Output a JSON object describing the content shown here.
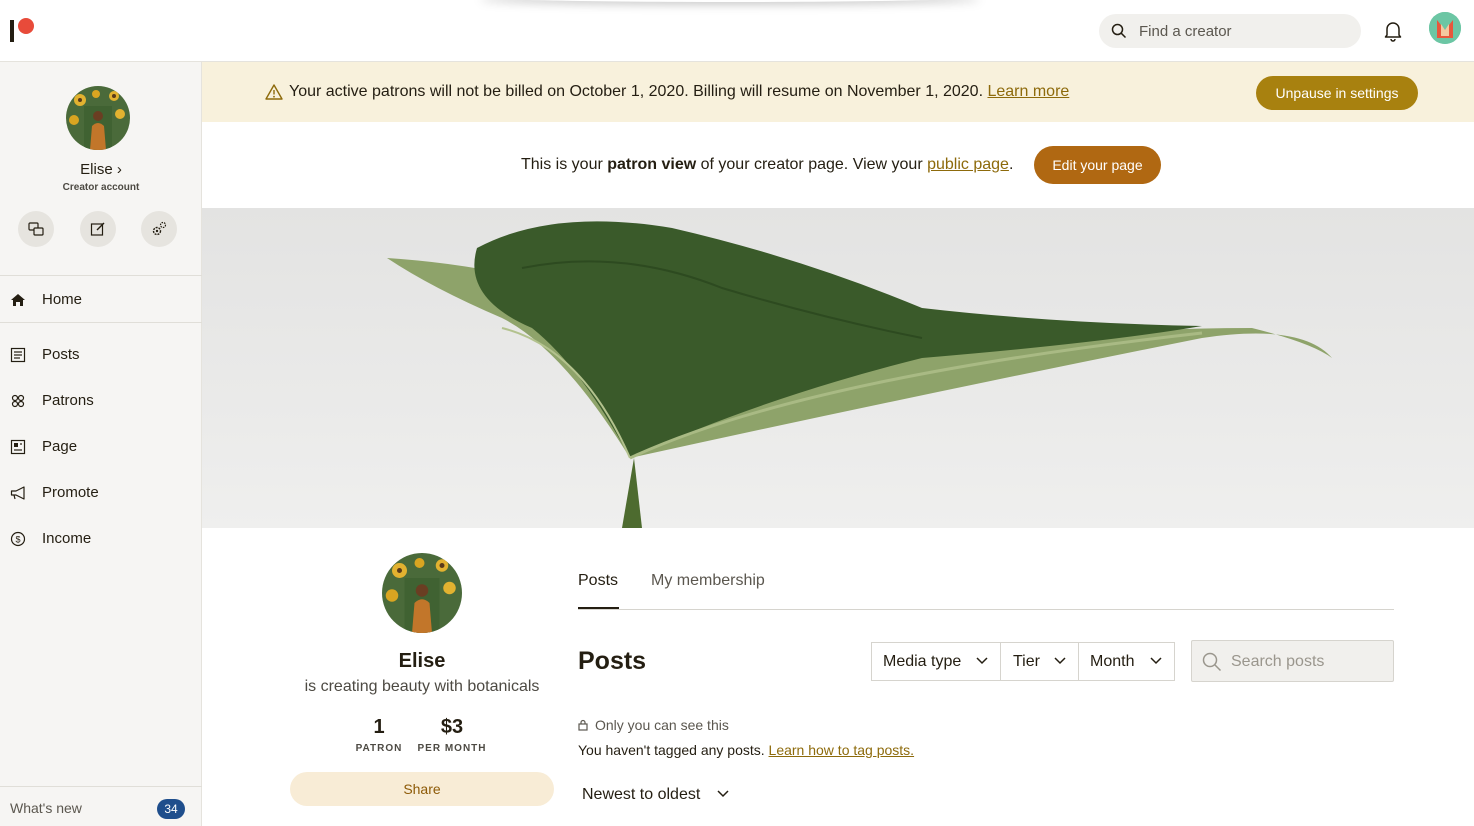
{
  "topbar": {
    "search_placeholder": "Find a creator"
  },
  "sidebar": {
    "profile_name": "Elise",
    "profile_sub": "Creator account",
    "nav": [
      {
        "label": "Home",
        "icon": "home-icon"
      },
      {
        "label": "Posts",
        "icon": "posts-icon"
      },
      {
        "label": "Patrons",
        "icon": "patrons-icon"
      },
      {
        "label": "Page",
        "icon": "page-icon"
      },
      {
        "label": "Promote",
        "icon": "megaphone-icon"
      },
      {
        "label": "Income",
        "icon": "dollar-circle-icon"
      }
    ],
    "whats_new": "What's new",
    "whats_new_count": "34"
  },
  "banner": {
    "text": "Your active patrons will not be billed on October 1, 2020. Billing will resume on November 1, 2020.",
    "link": "Learn more",
    "button": "Unpause in settings"
  },
  "patron_view": {
    "prefix": "This is your ",
    "bold": "patron view",
    "middle": " of your creator page. View your ",
    "link": "public page",
    "suffix": ".",
    "button": "Edit your page"
  },
  "profile": {
    "name": "Elise",
    "description": "is creating beauty with botanicals",
    "patron_count": "1",
    "patron_label": "PATRON",
    "price": "$3",
    "price_label": "PER MONTH",
    "share": "Share"
  },
  "tabs": [
    "Posts",
    "My membership"
  ],
  "posts": {
    "heading": "Posts",
    "filters": [
      "Media type",
      "Tier",
      "Month"
    ],
    "search_placeholder": "Search posts",
    "only_you": "Only you can see this",
    "untagged_text": "You haven't tagged any posts.",
    "untagged_link": "Learn how to tag posts.",
    "sort": "Newest to oldest"
  },
  "colors": {
    "accent": "#a8810f",
    "edit_button": "#b06812",
    "banner_bg": "#f8f1dc",
    "badge": "#1f4e8c",
    "logo_red": "#e84b3a"
  }
}
